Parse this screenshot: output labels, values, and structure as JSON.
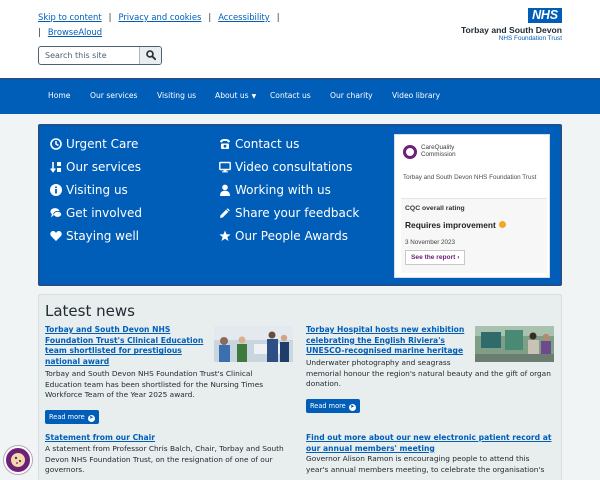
{
  "skip_links": {
    "skip": "Skip to content",
    "privacy": "Privacy and cookies",
    "accessibility": "Accessibility",
    "browsealoud": "BrowseAloud"
  },
  "search": {
    "placeholder": "Search this site"
  },
  "logo": {
    "nhs": "NHS",
    "trust": "Torbay and South Devon",
    "sub": "NHS Foundation Trust"
  },
  "nav": {
    "items": [
      "Home",
      "Our services",
      "Visiting us",
      "About us",
      "Contact us",
      "Our charity",
      "Video library"
    ]
  },
  "quick_links": [
    {
      "label": "Urgent Care",
      "icon": "clock-icon"
    },
    {
      "label": "Our services",
      "icon": "sort-icon"
    },
    {
      "label": "Visiting us",
      "icon": "info-icon"
    },
    {
      "label": "Get involved",
      "icon": "chat-icon"
    },
    {
      "label": "Staying well",
      "icon": "heart-icon"
    },
    {
      "label": "Contact us",
      "icon": "phone-icon"
    },
    {
      "label": "Video consultations",
      "icon": "monitor-icon"
    },
    {
      "label": "Working with us",
      "icon": "user-icon"
    },
    {
      "label": "Share your feedback",
      "icon": "pencil-icon"
    },
    {
      "label": "Our People Awards",
      "icon": "star-icon"
    }
  ],
  "cqc": {
    "logo_line1": "CareQuality",
    "logo_line2": "Commission",
    "org": "Torbay and South Devon NHS Foundation Trust",
    "rating_label": "CQC overall rating",
    "rating": "Requires improvement",
    "date": "3 November 2023",
    "button": "See the report",
    "colors": {
      "brand": "#6d2077",
      "rating_dot": "#f5a623"
    }
  },
  "news": {
    "heading": "Latest news",
    "read_more": "Read more",
    "articles": [
      {
        "title_lines": [
          "Torbay and South Devon NHS",
          "Foundation Trust's Clinical Education",
          "team shortlisted for prestigious",
          "national award"
        ],
        "text_lines": [
          "Torbay and South Devon NHS Foundation Trust's Clinical",
          "Education team has been shortlisted for the Nursing Times",
          "Workforce Team of the Year 2025 award."
        ]
      },
      {
        "title_lines": [
          "Torbay Hospital hosts new exhibition",
          "celebrating the English Riviera's",
          "UNESCO-recognised marine heritage"
        ],
        "text_lines": [
          "Underwater photography and seagrass",
          "memorial honour the region's natural beauty and the gift of organ",
          "donation."
        ]
      },
      {
        "title_lines": [
          "Statement from our Chair"
        ],
        "text_lines": [
          "A statement from Professor Chris Balch, Chair, Torbay and South",
          "Devon NHS Foundation Trust, on the resignation of one of our",
          "governors."
        ]
      },
      {
        "title_lines": [
          "Find out more about our new electronic patient record at",
          "our annual members' meeting"
        ],
        "text_lines": [
          "Governor Alison Ramon is encouraging people to attend this",
          "year's annual members meeting, to celebrate the organisation's"
        ]
      }
    ]
  },
  "colors": {
    "nhs_blue": "#005eb8",
    "dark_blue": "#1d4f91",
    "background": "#f0f4f5"
  }
}
